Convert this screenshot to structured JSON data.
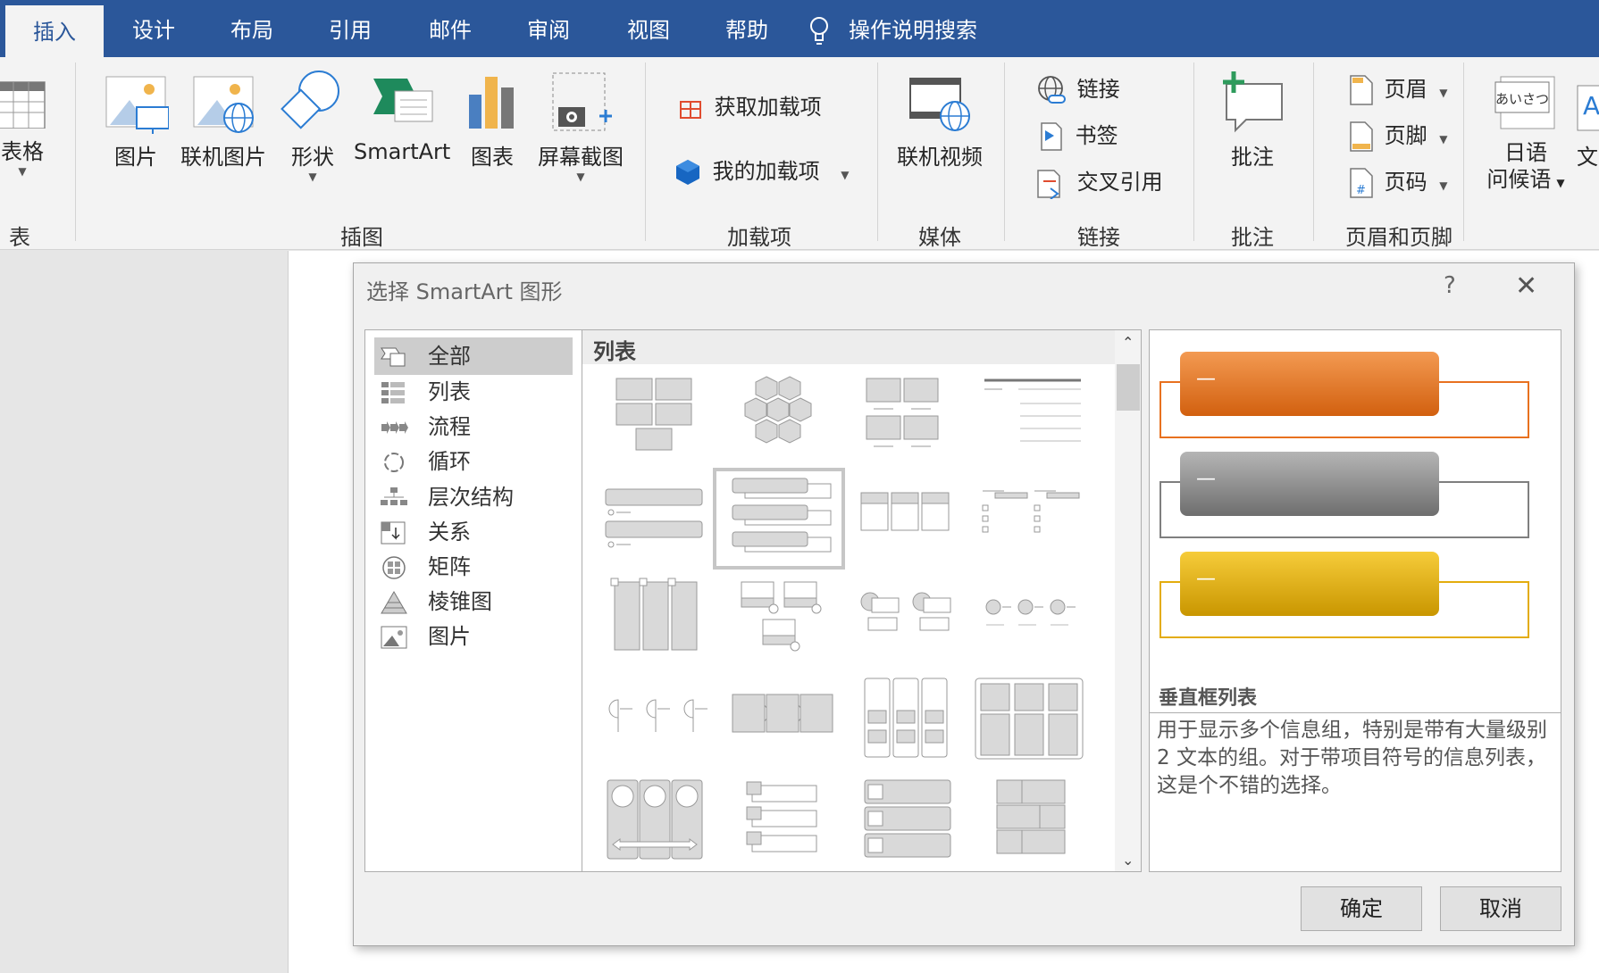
{
  "tabs": [
    "插入",
    "设计",
    "布局",
    "引用",
    "邮件",
    "审阅",
    "视图",
    "帮助"
  ],
  "search_label": "操作说明搜索",
  "ribbon": {
    "table_label": "表格",
    "table_group": "表格",
    "illustrations": {
      "picture": "图片",
      "online_picture": "联机图片",
      "shapes": "形状",
      "smartart": "SmartArt",
      "chart": "图表",
      "screenshot": "屏幕截图",
      "group": "插图"
    },
    "addins": {
      "get": "获取加载项",
      "my": "我的加载项",
      "group": "加载项"
    },
    "media": {
      "video": "联机视频",
      "group": "媒体"
    },
    "links": {
      "link": "链接",
      "bookmark": "书签",
      "crossref": "交叉引用",
      "group": "链接"
    },
    "comments": {
      "comment": "批注",
      "group": "批注"
    },
    "headerfooter": {
      "header": "页眉",
      "footer": "页脚",
      "pagenum": "页码",
      "group": "页眉和页脚"
    },
    "japanese": {
      "icon_text": "あいさつ",
      "line1": "日语",
      "line2": "问候语"
    },
    "text_partial": "文",
    "text_icon": "A"
  },
  "dialog": {
    "title": "选择 SmartArt 图形",
    "help": "?",
    "close": "✕",
    "categories": [
      "全部",
      "列表",
      "流程",
      "循环",
      "层次结构",
      "关系",
      "矩阵",
      "棱锥图",
      "图片"
    ],
    "gallery_header": "列表",
    "preview_bullet": "—",
    "preview_title": "垂直框列表",
    "preview_desc": "用于显示多个信息组，特别是带有大量级别 2 文本的组。对于带项目符号的信息列表，这是个不错的选择。",
    "ok": "确定",
    "cancel": "取消"
  },
  "colors": {
    "tabbar": "#2b579a",
    "orange": "#e8711f",
    "gray": "#7f7f7f",
    "gold": "#e3ac0d"
  }
}
